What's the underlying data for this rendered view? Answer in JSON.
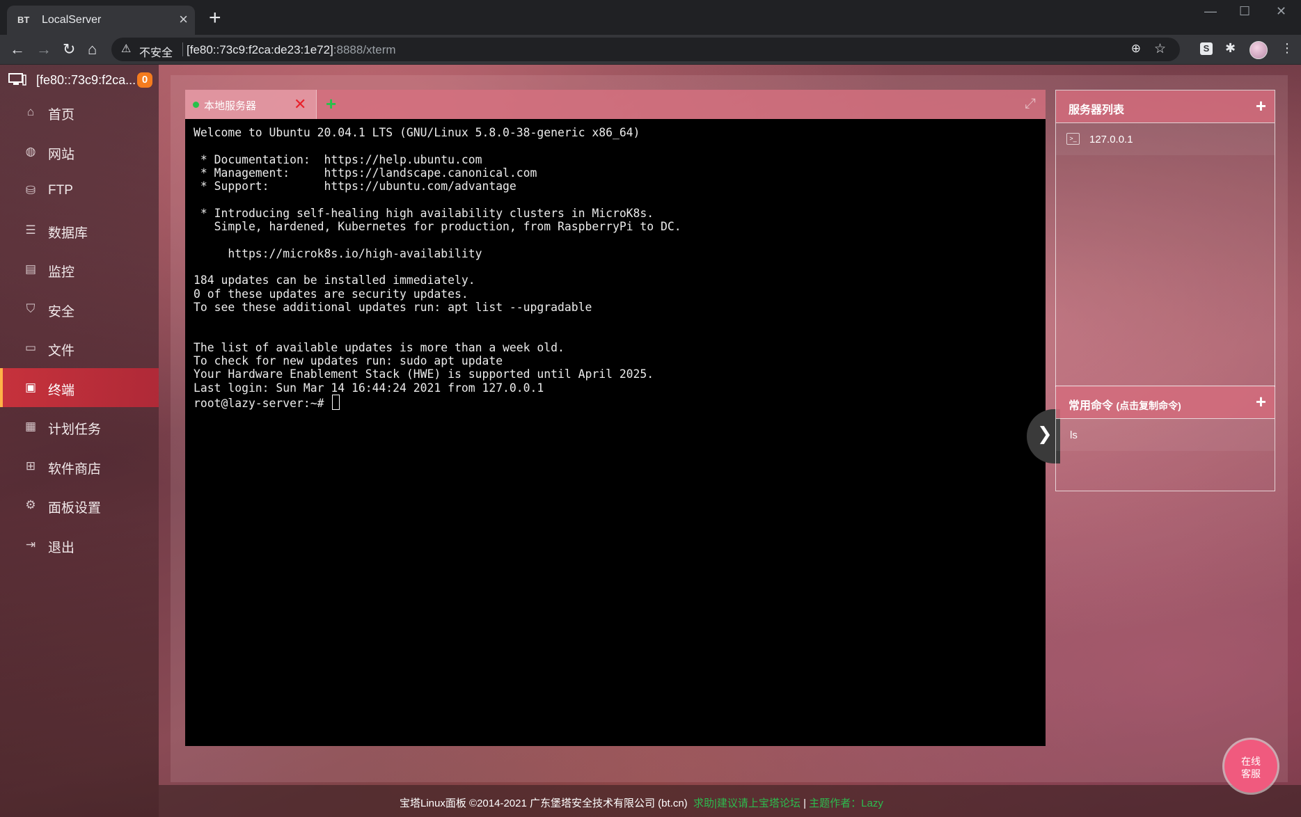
{
  "browser": {
    "tab_title": "LocalServer",
    "tab_favicon": "BT",
    "insecure_label": "不安全",
    "url_host": "[fe80::73c9:f2ca:de23:1e72]",
    "url_rest": ":8888/xterm"
  },
  "sidebar": {
    "host_name": "[fe80::73c9:f2ca...",
    "badge_count": "0",
    "items": [
      {
        "label": "首页",
        "icon": "home-icon"
      },
      {
        "label": "网站",
        "icon": "globe-icon"
      },
      {
        "label": "FTP",
        "icon": "ftp-icon"
      },
      {
        "label": "数据库",
        "icon": "database-icon"
      },
      {
        "label": "监控",
        "icon": "monitor-chart-icon"
      },
      {
        "label": "安全",
        "icon": "shield-icon"
      },
      {
        "label": "文件",
        "icon": "folder-icon"
      },
      {
        "label": "终端",
        "icon": "terminal-icon",
        "active": true
      },
      {
        "label": "计划任务",
        "icon": "calendar-icon"
      },
      {
        "label": "软件商店",
        "icon": "grid-apps-icon"
      },
      {
        "label": "面板设置",
        "icon": "gear-icon"
      },
      {
        "label": "退出",
        "icon": "logout-icon"
      }
    ]
  },
  "terminal": {
    "tab_label": "本地服务器",
    "lines": [
      "Welcome to Ubuntu 20.04.1 LTS (GNU/Linux 5.8.0-38-generic x86_64)",
      "",
      " * Documentation:  https://help.ubuntu.com",
      " * Management:     https://landscape.canonical.com",
      " * Support:        https://ubuntu.com/advantage",
      "",
      " * Introducing self-healing high availability clusters in MicroK8s.",
      "   Simple, hardened, Kubernetes for production, from RaspberryPi to DC.",
      "",
      "     https://microk8s.io/high-availability",
      "",
      "184 updates can be installed immediately.",
      "0 of these updates are security updates.",
      "To see these additional updates run: apt list --upgradable",
      "",
      "",
      "The list of available updates is more than a week old.",
      "To check for new updates run: sudo apt update",
      "Your Hardware Enablement Stack (HWE) is supported until April 2025.",
      "Last login: Sun Mar 14 16:44:24 2021 from 127.0.0.1"
    ],
    "prompt": "root@lazy-server:~# "
  },
  "server_list": {
    "title": "服务器列表",
    "servers": [
      "127.0.0.1"
    ]
  },
  "commands": {
    "title": "常用命令",
    "hint": "(点击复制命令)",
    "items": [
      "ls"
    ]
  },
  "footer": {
    "copyright": "宝塔Linux面板 ©2014-2021 广东堡塔安全技术有限公司 (bt.cn)",
    "forum_link": "求助|建议请上宝塔论坛",
    "divider": "|",
    "theme_author": "主题作者：Lazy"
  },
  "chat_button": {
    "line1": "在线",
    "line2": "客服"
  },
  "colors": {
    "accent": "#cc323c",
    "badge": "#f57c1f",
    "green": "#26c24a"
  }
}
